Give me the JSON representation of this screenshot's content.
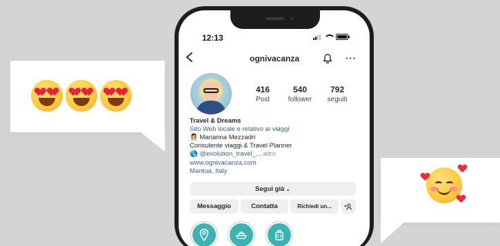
{
  "status_bar": {
    "time": "12:13"
  },
  "header": {
    "username": "ognivacanza"
  },
  "profile": {
    "stats": [
      {
        "value": "416",
        "label": "Post"
      },
      {
        "value": "540",
        "label": "follower"
      },
      {
        "value": "792",
        "label": "seguiti"
      }
    ],
    "name": "Travel & Dreams",
    "category": "Sito Web locale e relativo ai viaggi",
    "bio_lines": [
      "👩‍💼 Marianna Mezzadri",
      "Consulente viaggi & Travel Planner"
    ],
    "mention": "🌎 @evolution_travel_...",
    "more_label": "altro",
    "website": "www.ognivacanza.com",
    "location": "Mantua, Italy"
  },
  "actions": {
    "following_label": "Segui già",
    "message_label": "Messaggio",
    "contact_label": "Contatta",
    "request_label": "Richiedi un..."
  },
  "highlights": [
    {
      "icon": "map-pin-icon"
    },
    {
      "icon": "ship-icon"
    },
    {
      "icon": "suitcase-icon"
    }
  ],
  "colors": {
    "background": "#d4d4d4",
    "link": "#3d5f92",
    "highlight": "#3bb3b3",
    "button": "#efefef"
  }
}
